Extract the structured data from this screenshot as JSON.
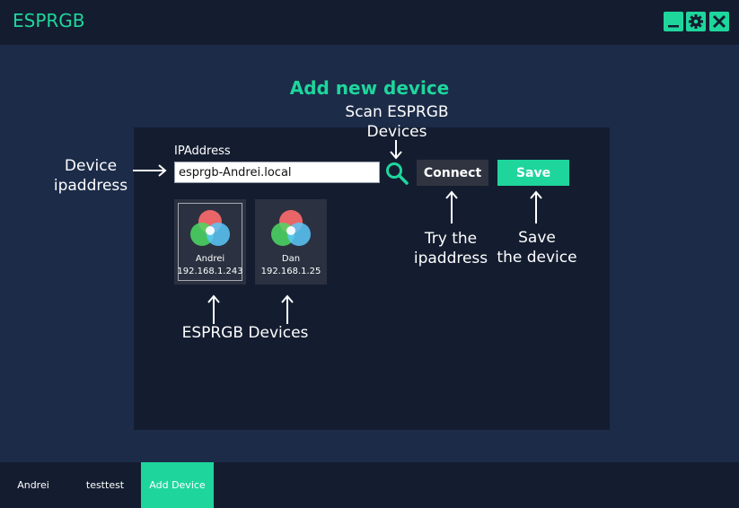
{
  "app": {
    "title": "ESPRGB"
  },
  "window_buttons": [
    "minimize-icon",
    "gear-icon",
    "close-icon"
  ],
  "main": {
    "heading": "Add new device",
    "ip_label": "IPAddress",
    "ip_value": "esprgb-Andrei.local",
    "connect_label": "Connect",
    "save_label": "Save"
  },
  "devices": [
    {
      "name": "Andrei",
      "ip": "192.168.1.243",
      "selected": true
    },
    {
      "name": "Dan",
      "ip": "192.168.1.25",
      "selected": false
    }
  ],
  "annotations": {
    "device_ip": [
      "Device",
      "ipaddress"
    ],
    "scan": [
      "Scan ESPRGB",
      "Devices"
    ],
    "try": [
      "Try the",
      "ipaddress"
    ],
    "save": [
      "Save",
      "the device"
    ],
    "devices": "ESPRGB Devices"
  },
  "tabs": [
    {
      "label": "Andrei",
      "active": false
    },
    {
      "label": "testtest",
      "active": false
    },
    {
      "label": "Add Device",
      "active": true
    }
  ],
  "colors": {
    "accent": "#1ed69c",
    "background": "#1c2b48",
    "panel": "#141d30",
    "button_dark": "#2f3440",
    "card": "#2b3140"
  }
}
